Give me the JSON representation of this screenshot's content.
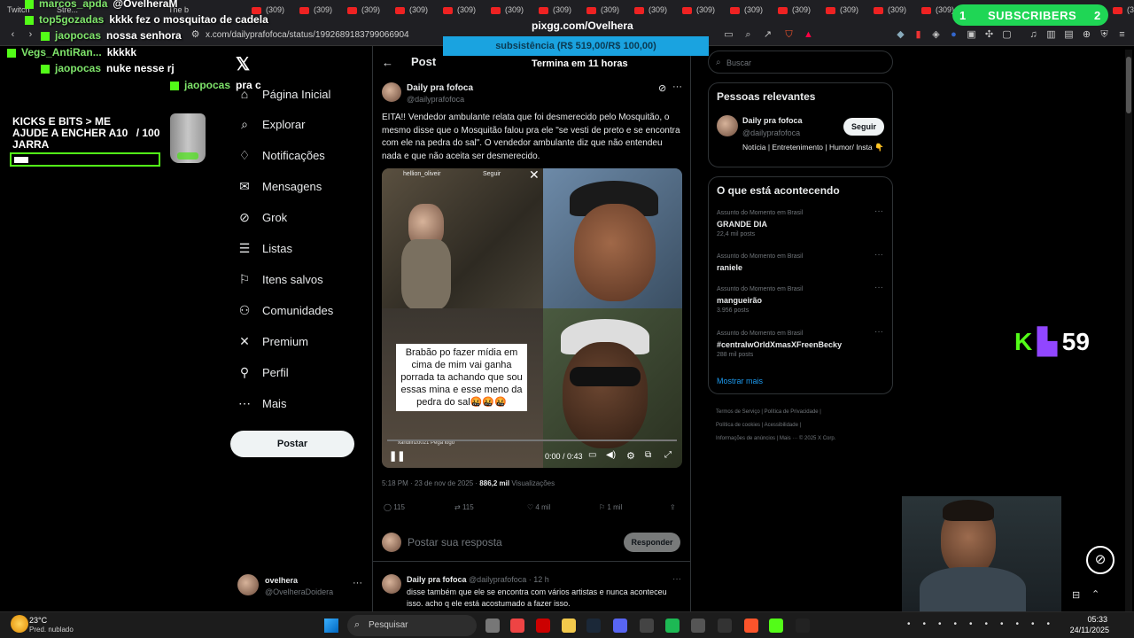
{
  "browser": {
    "tabs": [
      "Twitch",
      "Stre...",
      "",
      "The b",
      "(309)",
      "(309)",
      "(309)",
      "(309)",
      "(309)",
      "(309)",
      "(309)",
      "(309)",
      "(309)",
      "(309)",
      "(309)",
      "(309)",
      "(309)",
      "(309)",
      "(309)",
      "(309)",
      "(309)",
      "(309)",
      "(309)",
      "(309)"
    ],
    "url": "x.com/dailyprafofoca/status/1992689183799066904"
  },
  "overlay": {
    "chat": [
      {
        "user": "marcos_apda",
        "msg": "@OvelheraM"
      },
      {
        "user": "top5gozadas",
        "msg": "kkkk fez o mosquitao de cadela"
      },
      {
        "user": "jaopocas",
        "msg": "nossa senhora"
      },
      {
        "user": "Vegs_AntiRan...",
        "msg": "kkkkk"
      },
      {
        "user": "jaopocas",
        "msg": "nuke nesse rj"
      },
      {
        "user": "jaopocas",
        "msg": "pra c"
      }
    ],
    "kick_bits": "KICKS E BITS > ME AJUDE A ENCHER A",
    "jar_current": "10",
    "jar_total": "/ 100",
    "jar_word": "JARRA",
    "jar_fill_fraction": 0.1,
    "subs_left": "1",
    "subs_label": "SUBSCRIBERS",
    "subs_right": "2",
    "pix": "pixgg.com/Ovelhera",
    "subsistencia": "subsistência (R$ 519,00/R$ 100,00)",
    "timer": "Termina em 11 horas",
    "counter": "59"
  },
  "nav": {
    "items": [
      {
        "label": "Página Inicial",
        "icon": "home-icon",
        "glyph": "⌂"
      },
      {
        "label": "Explorar",
        "icon": "search-icon",
        "glyph": "⌕"
      },
      {
        "label": "Notificações",
        "icon": "bell-icon",
        "glyph": "♢"
      },
      {
        "label": "Mensagens",
        "icon": "mail-icon",
        "glyph": "✉"
      },
      {
        "label": "Grok",
        "icon": "grok-icon",
        "glyph": "⊘"
      },
      {
        "label": "Listas",
        "icon": "list-icon",
        "glyph": "☰"
      },
      {
        "label": "Itens salvos",
        "icon": "bookmark-icon",
        "glyph": "⚐"
      },
      {
        "label": "Comunidades",
        "icon": "community-icon",
        "glyph": "⚇"
      },
      {
        "label": "Premium",
        "icon": "x-premium-icon",
        "glyph": "✕"
      },
      {
        "label": "Perfil",
        "icon": "profile-icon",
        "glyph": "⚲"
      },
      {
        "label": "Mais",
        "icon": "more-icon",
        "glyph": "⋯"
      }
    ],
    "post_button": "Postar",
    "account_name": "ovelhera",
    "account_handle": "@OvelheraDoidera"
  },
  "post": {
    "header": "Post",
    "author": "Daily pra fofoca",
    "handle": "@dailyprafofoca",
    "text": "EITA!! Vendedor ambulante relata que foi desmerecido pelo Mosquitão, o mesmo disse que o Mosquitão falou pra ele \"se vesti de preto e se encontra com ele na pedra do sal\". O vendedor ambulante diz que não entendeu nada e que não aceita ser desmerecido.",
    "video_overlay_user": "hellion_oliveir",
    "video_follow": "Seguir",
    "video_caption": "Brabão po fazer mídia em cima de mim vai ganha porrada ta achando que sou essas mina e esse meno da pedra do sal🤬🤬🤬",
    "video_credit": "xandlinzo021 Pega logo",
    "video_time": "0:00 / 0:43",
    "video_progress_fraction": 0.0,
    "timestamp": "5:18 PM · 23 de nov de 2025 · ",
    "views": "886,2 mil",
    "views_label": "Visualizações",
    "replies": "115",
    "reposts": "115",
    "likes": "4 mil",
    "bookmarks": "1 mil",
    "reply_placeholder": "Postar sua resposta",
    "reply_button": "Responder",
    "reply2_author": "Daily pra fofoca",
    "reply2_handle": "@dailyprafofoca · 12 h",
    "reply2_text": "disse também que ele se encontra com vários artistas e nunca aconteceu isso. acho q ele está acostumado a fazer isso."
  },
  "sidebar": {
    "search_placeholder": "Buscar",
    "relevant_title": "Pessoas relevantes",
    "person_name": "Daily pra fofoca",
    "person_handle": "@dailyprafofoca",
    "follow_button": "Seguir",
    "person_bio": "Notícia | Entretenimento | Humor/ Insta 👇",
    "trends_title": "O que está acontecendo",
    "trends": [
      {
        "context": "Assunto do Momento em Brasil",
        "name": "GRANDE DIA",
        "count": "22,4 mil posts"
      },
      {
        "context": "Assunto do Momento em Brasil",
        "name": "raniele",
        "count": ""
      },
      {
        "context": "Assunto do Momento em Brasil",
        "name": "mangueirão",
        "count": "3.956 posts"
      },
      {
        "context": "Assunto do Momento em Brasil",
        "name": "#centralwOrldXmasXFreenBecky",
        "count": "288 mil posts"
      }
    ],
    "show_more": "Mostrar mais",
    "footer_lines": [
      "Termos de Serviço  |  Política de Privacidade  |",
      "Política de cookies  |  Acessibilidade  |",
      "Informações de anúncios  |  Mais ···  © 2025 X Corp."
    ]
  },
  "taskbar": {
    "weather_temp": "23°C",
    "weather_desc": "Pred. nublado",
    "search": "Pesquisar",
    "time": "05:33",
    "date": "24/11/2025"
  },
  "colors": {
    "kick": "#53fc18",
    "twitch": "#9146ff",
    "subs": "#1fd655",
    "link": "#1d9bf0"
  }
}
